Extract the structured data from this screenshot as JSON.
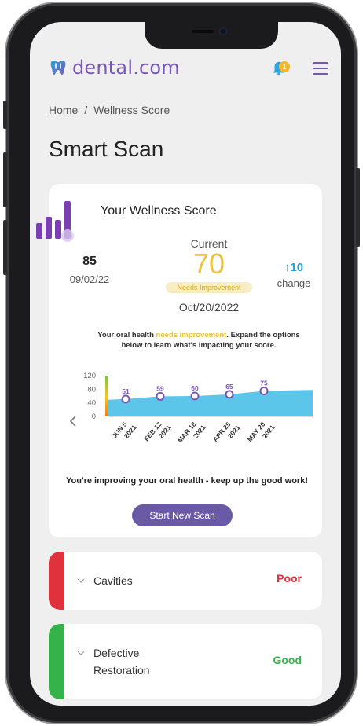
{
  "header": {
    "brand": "dental.com",
    "notification_count": "1",
    "brand_color": "#7a56b3"
  },
  "breadcrumb": {
    "home": "Home",
    "separator": "/",
    "current": "Wellness Score"
  },
  "page": {
    "title": "Smart Scan"
  },
  "wellness": {
    "title": "Your Wellness Score",
    "previous_score": "85",
    "previous_date": "09/02/22",
    "current_label": "Current",
    "current_score": "70",
    "status_pill": "Needs Improvement",
    "current_date": "Oct/20/2022",
    "change_value": "↑10",
    "change_label": "change",
    "message_before": "Your oral health ",
    "message_highlight": "needs improvement",
    "message_after": ". Expand the options below to learn what's impacting your score.",
    "bottom_message": "You're improving your oral health - keep up the good work!",
    "scan_button": "Start New Scan"
  },
  "chart_data": {
    "type": "area",
    "x": [
      "JUN 5 2021",
      "FEB 12 2021",
      "MAR 18 2021",
      "APR 25 2021",
      "MAY 20 2021"
    ],
    "series": [
      {
        "values": [
          51,
          59,
          60,
          65,
          75
        ]
      }
    ],
    "yticks": [
      0,
      40,
      80,
      120
    ],
    "ylim": [
      0,
      120
    ],
    "fill_color": "#5bc5ea",
    "point_color": "#7a56b3"
  },
  "categories": [
    {
      "label": "Cavities",
      "status": "Poor",
      "color": "#e0323d"
    },
    {
      "label": "Defective Restoration",
      "status": "Good",
      "color": "#36b24a"
    }
  ]
}
